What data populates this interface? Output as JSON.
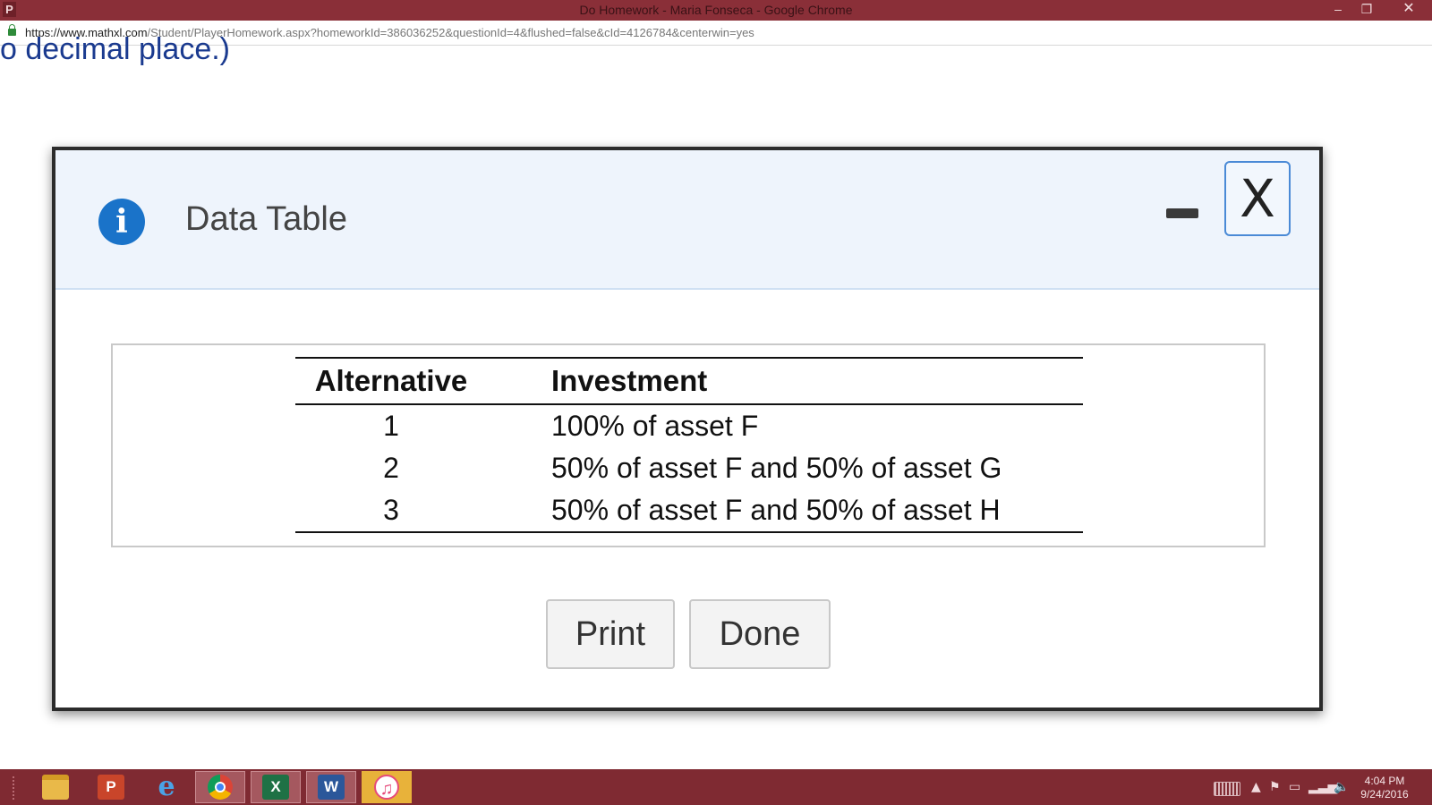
{
  "browser": {
    "badge": "P",
    "title": "Do Homework - Maria Fonseca - Google Chrome",
    "url_host": "https://www.mathxl.com",
    "url_path": "/Student/PlayerHomework.aspx?homeworkId=386036252&questionId=4&flushed=false&cId=4126784&centerwin=yes",
    "controls": {
      "minimize": "–",
      "maximize": "❐",
      "close": "✕"
    }
  },
  "page": {
    "background_text": "o decimal place.)"
  },
  "dialog": {
    "info_icon": "i",
    "title": "Data Table",
    "close_label": "X",
    "table": {
      "headers": [
        "Alternative",
        "Investment"
      ],
      "rows": [
        [
          "1",
          "100% of asset F"
        ],
        [
          "2",
          "50% of asset F and 50% of asset G"
        ],
        [
          "3",
          "50% of asset F and 50% of asset H"
        ]
      ]
    },
    "buttons": {
      "print": "Print",
      "done": "Done"
    }
  },
  "taskbar": {
    "apps": [
      {
        "name": "file-explorer",
        "label": ""
      },
      {
        "name": "powerpoint",
        "label": "P"
      },
      {
        "name": "internet-explorer",
        "label": "e"
      },
      {
        "name": "chrome",
        "label": ""
      },
      {
        "name": "excel",
        "label": "X"
      },
      {
        "name": "word",
        "label": "W"
      },
      {
        "name": "itunes",
        "label": "♫"
      }
    ],
    "clock": {
      "time": "4:04 PM",
      "date": "9/24/2016"
    }
  },
  "colors": {
    "titlebar": "#8a2f38",
    "taskbar": "#7f2a32",
    "dialog_header": "#eef4fc",
    "info_icon": "#1a73c9",
    "page_text": "#1a3a8f"
  }
}
